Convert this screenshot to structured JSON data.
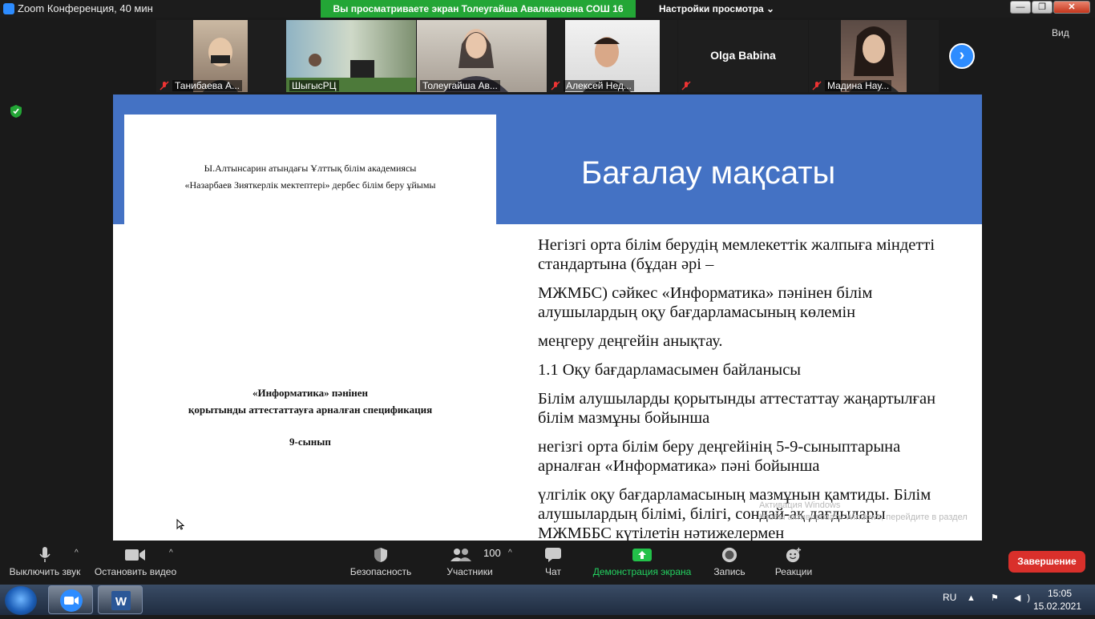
{
  "window": {
    "title": "Zoom Конференция, 40 мин",
    "share_banner": "Вы просматриваете экран Толеугайша Авалкановна СОШ 16",
    "view_options": "Настройки просмотра ⌄",
    "min_label": "—",
    "max_label": "❐",
    "close_label": "✕"
  },
  "gallery": {
    "participants": [
      {
        "name": "Танибаева А..."
      },
      {
        "name": "ШыгысРЦ"
      },
      {
        "name": "Толеугайша Ав..."
      },
      {
        "name": "Алексей Нед..."
      },
      {
        "name": "Olga Babina"
      },
      {
        "name": "Мадина Нау..."
      }
    ],
    "view_label": "Вид",
    "next_label": "›",
    "raise_hand": "✋"
  },
  "document": {
    "org_line1": "Ы.Алтынсарин атындағы Ұлттық білім академиясы",
    "org_line2": "«Назарбаев Зияткерлік мектептері» дербес білім беру ұйымы",
    "title_line1": "«Информатика» пәнінен",
    "title_line2": "қорытынды аттестаттауға арналған спецификация",
    "grade": "9-сынып"
  },
  "slide": {
    "title": "Бағалау мақсаты",
    "paragraphs": [
      "Негізгі орта білім берудің мемлекеттік жалпыға міндетті стандартына (бұдан әрі –",
      "МЖМБС) сәйкес «Информатика» пәнінен білім алушылардың оқу бағдарламасының көлемін",
      "меңгеру деңгейін анықтау.",
      "1.1 Оқу бағдарламасымен байланысы",
      "Білім алушыларды қорытынды аттестаттау жаңартылған білім мазмұны бойынша",
      "негізгі орта білім беру деңгейінің 5-9-сыныптарына арналған «Информатика» пәні бойынша",
      "үлгілік оқу бағдарламасының мазмұнын қамтиды. Білім алушылардың білімі, білігі, сондай-ақ дағдылары МЖМББС күтілетін нәтижелермен"
    ],
    "watermark_line1": "Активация Windows",
    "watermark_line2": "Чтобы активировать Windows, перейдите в раздел"
  },
  "toolbar": {
    "mute": "Выключить звук",
    "video": "Остановить видео",
    "security": "Безопасность",
    "participants": "Участники",
    "participants_count": "100",
    "chat": "Чат",
    "share": "Демонстрация экрана",
    "record": "Запись",
    "reactions": "Реакции",
    "end": "Завершение",
    "caret": "^"
  },
  "taskbar": {
    "lang": "RU",
    "tray": "▲ ⚑ ◀)",
    "time": "15:05",
    "date": "15.02.2021",
    "word_label": "W"
  },
  "colors": {
    "slide_blue": "#4472c4",
    "zoom_blue": "#2d8cff",
    "share_green": "#23a636",
    "end_red": "#d9302b"
  }
}
